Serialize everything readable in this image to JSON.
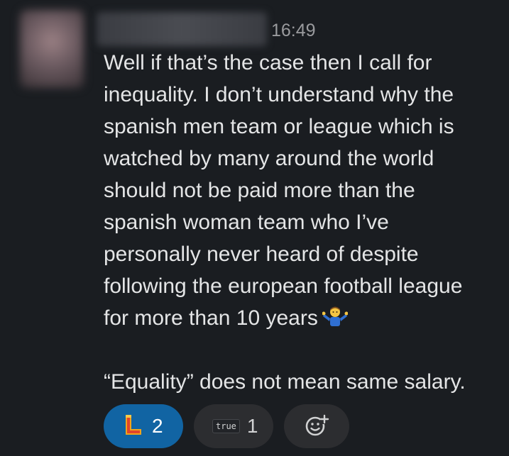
{
  "message": {
    "timestamp": "16:49",
    "paragraph1": "Well if that’s the case then I call for\ninequality. I don’t understand why the\nspanish men team or league which is\nwatched by many around the world\nshould not be paid more than the\nspanish woman team who I’ve\npersonally never heard of despite\nfollowing the european football league\nfor more than 10 years",
    "inline_emoji": "person-shrugging-emoji",
    "paragraph2": "“Equality” does not mean same salary."
  },
  "reactions": [
    {
      "emoji": "letter-l-emoji",
      "count": "2",
      "selected": true
    },
    {
      "emoji": "true-badge-emoji",
      "label": "true",
      "count": "1",
      "selected": false
    }
  ],
  "add_reaction": {
    "icon": "add-reaction-icon"
  },
  "colors": {
    "background": "#1a1d21",
    "text": "#e4e5e6",
    "timestamp": "#9a9b9e",
    "reaction_selected": "#1164a3",
    "reaction_default": "#2c2d30"
  }
}
